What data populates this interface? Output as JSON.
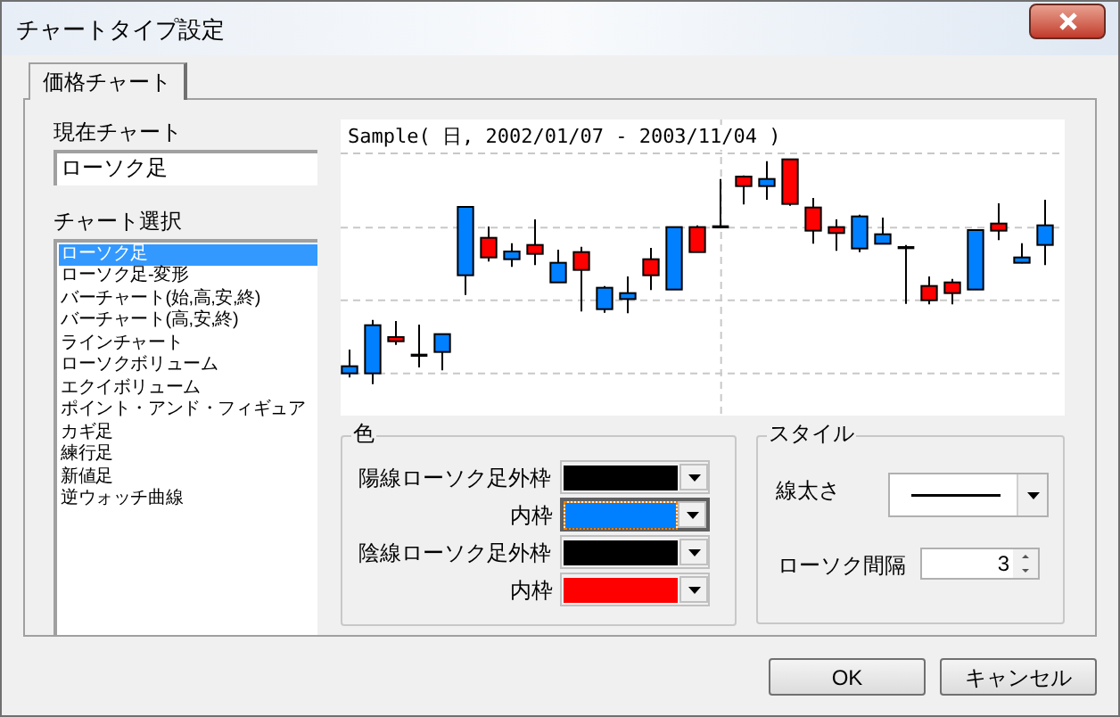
{
  "window": {
    "title": "チャートタイプ設定"
  },
  "tabs": [
    {
      "label": "価格チャート",
      "selected": true
    }
  ],
  "current_chart": {
    "label": "現在チャート",
    "value": "ローソク足"
  },
  "chart_select": {
    "label": "チャート選択",
    "items": [
      {
        "label": "ローソク足",
        "selected": true
      },
      {
        "label": "ローソク足-変形",
        "selected": false
      },
      {
        "label": "バーチャート(始,高,安,終)",
        "selected": false
      },
      {
        "label": "バーチャート(高,安,終)",
        "selected": false
      },
      {
        "label": "ラインチャート",
        "selected": false
      },
      {
        "label": "ローソクボリューム",
        "selected": false
      },
      {
        "label": "エクイボリューム",
        "selected": false
      },
      {
        "label": "ポイント・アンド・フィギュア",
        "selected": false
      },
      {
        "label": "カギ足",
        "selected": false
      },
      {
        "label": "練行足",
        "selected": false
      },
      {
        "label": "新値足",
        "selected": false
      },
      {
        "label": "逆ウォッチ曲線",
        "selected": false
      }
    ]
  },
  "preview": {
    "title": "Sample( 日, 2002/01/07 - 2003/11/04 )"
  },
  "color_group": {
    "title": "色",
    "rows": [
      {
        "label": "陽線ローソク足外枠",
        "color": "#000000",
        "focused": false
      },
      {
        "label": "内枠",
        "color": "#0080ff",
        "focused": true
      },
      {
        "label": "陰線ローソク足外枠",
        "color": "#000000",
        "focused": false
      },
      {
        "label": "内枠",
        "color": "#ff0000",
        "focused": false
      }
    ]
  },
  "style_group": {
    "title": "スタイル",
    "line_width": {
      "label": "線太さ"
    },
    "candle_spacing": {
      "label": "ローソク間隔",
      "value": "3"
    }
  },
  "buttons": [
    {
      "label": "OK"
    },
    {
      "label": "キャンセル"
    }
  ]
}
